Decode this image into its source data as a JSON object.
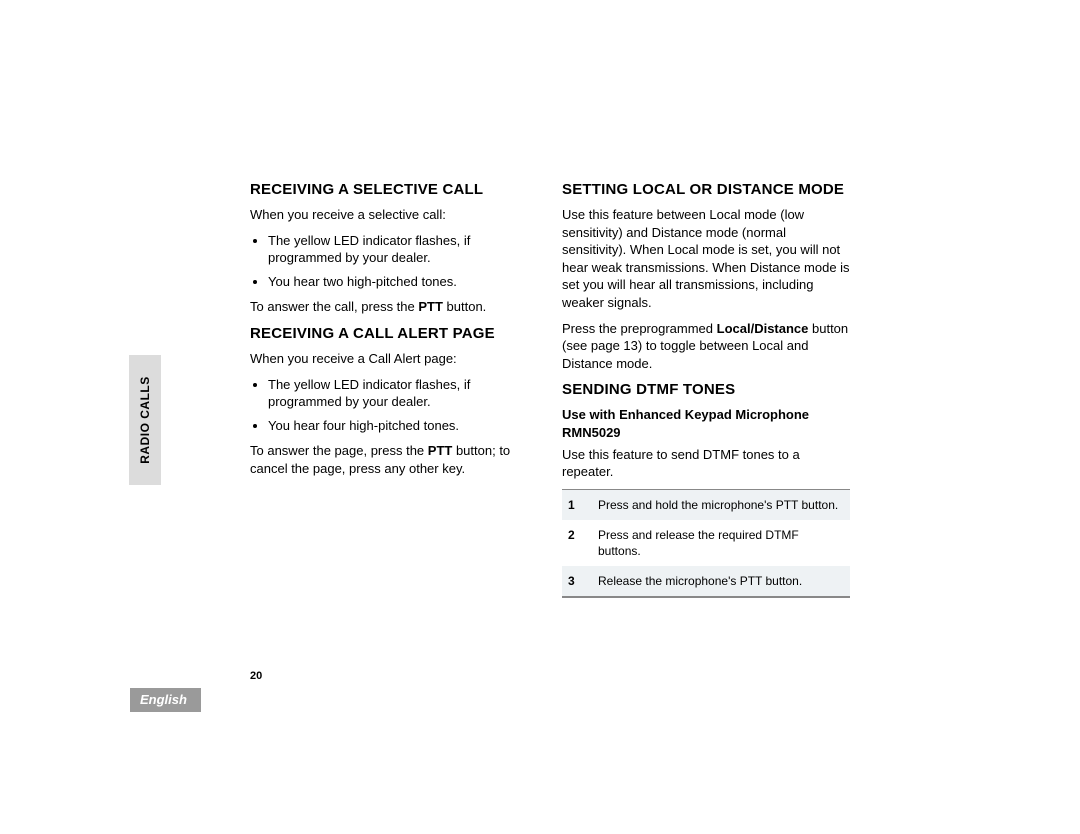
{
  "tab": "RADIO CALLS",
  "page_number": "20",
  "language": "English",
  "col1": {
    "h1": "RECEIVING A SELECTIVE CALL",
    "p1": "When you receive a selective call:",
    "b1": "The yellow LED indicator flashes, if programmed by your dealer.",
    "b2": "You hear two high-pitched tones.",
    "p2a": "To answer the call, press the ",
    "p2b": "PTT",
    "p2c": " button.",
    "h2": "RECEIVING A CALL ALERT PAGE",
    "p3": "When you receive a Call Alert page:",
    "b3": "The yellow LED indicator flashes, if programmed by your dealer.",
    "b4": "You hear four high-pitched tones.",
    "p4a": "To answer the page, press the ",
    "p4b": "PTT",
    "p4c": " button; to cancel the page, press any other key."
  },
  "col2": {
    "h1": "SETTING LOCAL OR DISTANCE MODE",
    "p1": "Use this feature between Local mode (low sensitivity) and Distance mode (normal sensitivity). When Local mode is set, you will not hear weak transmissions. When Distance mode is set you will hear all transmissions, including weaker signals.",
    "p2a": "Press the preprogrammed ",
    "p2b": "Local/Distance",
    "p2c": " button (see page 13) to toggle between Local and Distance mode.",
    "h2": "SENDING DTMF TONES",
    "sub": "Use with Enhanced Keypad Microphone RMN5029",
    "p3": "Use this feature to send DTMF tones to a repeater.",
    "steps": [
      {
        "n": "1",
        "t": "Press and hold the microphone's PTT button."
      },
      {
        "n": "2",
        "t": "Press and release the required DTMF buttons."
      },
      {
        "n": "3",
        "t": "Release the microphone's PTT button."
      }
    ]
  }
}
